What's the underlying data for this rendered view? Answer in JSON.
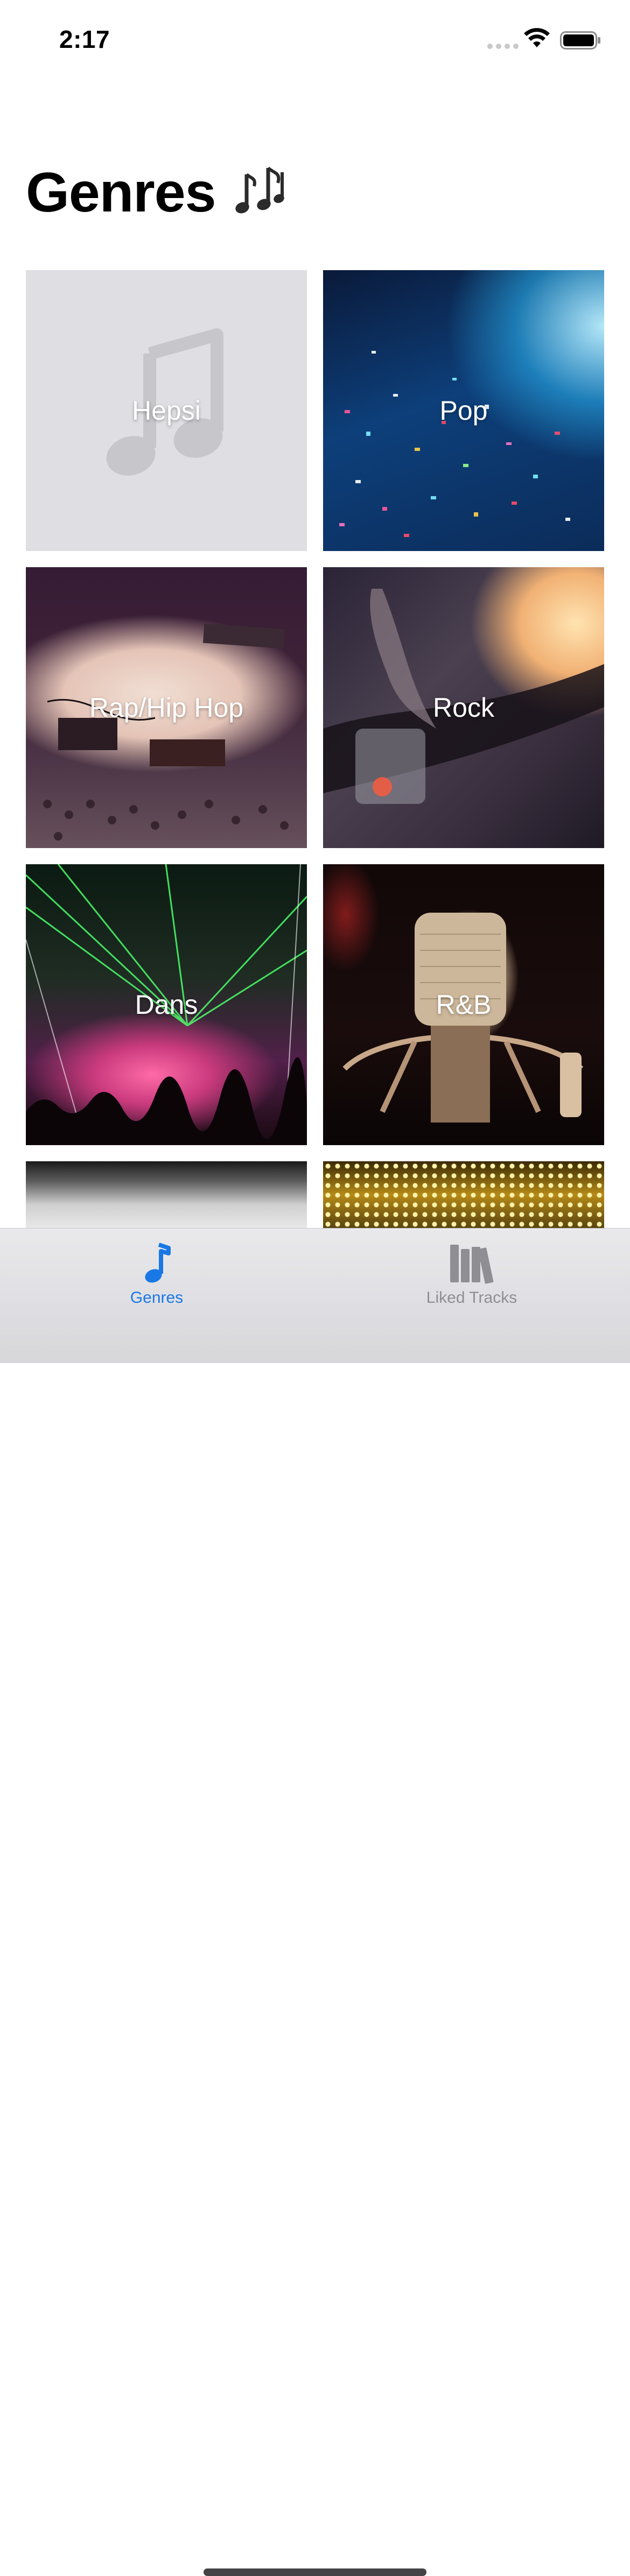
{
  "status_bar": {
    "time": "2:17"
  },
  "header": {
    "title": "Genres"
  },
  "genres": [
    {
      "label": "Hepsi"
    },
    {
      "label": "Pop"
    },
    {
      "label": "Rap/Hip Hop"
    },
    {
      "label": "Rock"
    },
    {
      "label": "Dans"
    },
    {
      "label": "R&B"
    }
  ],
  "tab_bar": {
    "items": [
      {
        "label": "Genres",
        "icon": "music-note-icon",
        "selected": true,
        "color": "#1a78e6"
      },
      {
        "label": "Liked Tracks",
        "icon": "library-icon",
        "selected": false,
        "color": "#8e8e93"
      }
    ]
  }
}
